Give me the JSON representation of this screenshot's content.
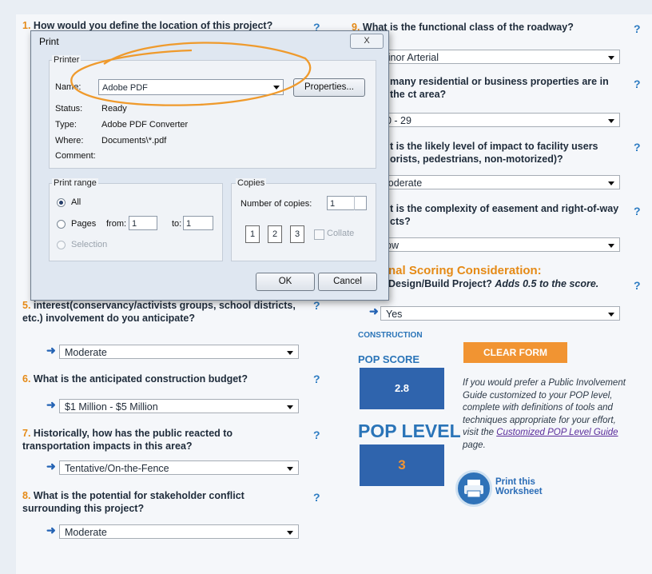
{
  "questions": {
    "q1": {
      "num": "1.",
      "text": "How would you define the location of this project?"
    },
    "q5": {
      "num": "5.",
      "text_partial": "interest(conservancy/activists groups, school districts, etc.) involvement do you anticipate?",
      "answer": "Moderate"
    },
    "q6": {
      "num": "6.",
      "text": "What is the anticipated construction budget?",
      "answer": "$1 Million - $5 Million"
    },
    "q7": {
      "num": "7.",
      "text": "Historically, how has the public reacted to transportation impacts in this area?",
      "answer": "Tentative/On-the-Fence"
    },
    "q8": {
      "num": "8.",
      "text": "What is the potential for stakeholder conflict surrounding this project?",
      "answer": "Moderate"
    },
    "q9": {
      "num": "9.",
      "text": "What is the functional class of the roadway?",
      "answer": "linor Arterial"
    },
    "q10": {
      "text": "many residential or business properties are in the ct area?",
      "answer": "0 - 29"
    },
    "q11": {
      "text": "t is the likely level of impact to facility users orists, pedestrians, non-motorized)?",
      "answer": "loderate"
    },
    "q12": {
      "text": "t is the complexity of easement and right-of-way cts?",
      "answer": "ow"
    },
    "special": {
      "title": "nal Scoring Consideration:",
      "text": "Design/Build Project?",
      "note": "Adds 0.5 to the score.",
      "answer": "Yes"
    }
  },
  "help_label": "?",
  "results": {
    "construction_label": "CONSTRUCTION",
    "pop_score_label": "POP SCORE",
    "pop_score": "2.8",
    "pop_level_label": "POP LEVEL",
    "pop_level": "3",
    "clear_label": "CLEAR FORM",
    "info_text": "If you would prefer a Public Involvement Guide customized to your POP level, complete with definitions of tools and techniques appropriate for your effort, visit the",
    "info_link": "Customized POP Level Guide",
    "info_tail": "page.",
    "print_label_1": "Print this",
    "print_label_2": "Worksheet"
  },
  "dialog": {
    "title": "Print",
    "close": "X",
    "printer_group": "Printer",
    "name_label": "Name:",
    "name_value": "Adobe PDF",
    "properties_label": "Properties...",
    "status_label": "Status:",
    "status_value": "Ready",
    "type_label": "Type:",
    "type_value": "Adobe PDF Converter",
    "where_label": "Where:",
    "where_value": "Documents\\*.pdf",
    "comment_label": "Comment:",
    "range_group": "Print range",
    "all_label": "All",
    "pages_label": "Pages",
    "from_label": "from:",
    "from_value": "1",
    "to_label": "to:",
    "to_value": "1",
    "selection_label": "Selection",
    "copies_group": "Copies",
    "copies_label": "Number of copies:",
    "copies_value": "1",
    "collate_label": "Collate",
    "ok_label": "OK",
    "cancel_label": "Cancel"
  },
  "colors": {
    "accent": "#e58a16",
    "blue": "#2f64ad",
    "annotation": "#ef9a2c"
  }
}
